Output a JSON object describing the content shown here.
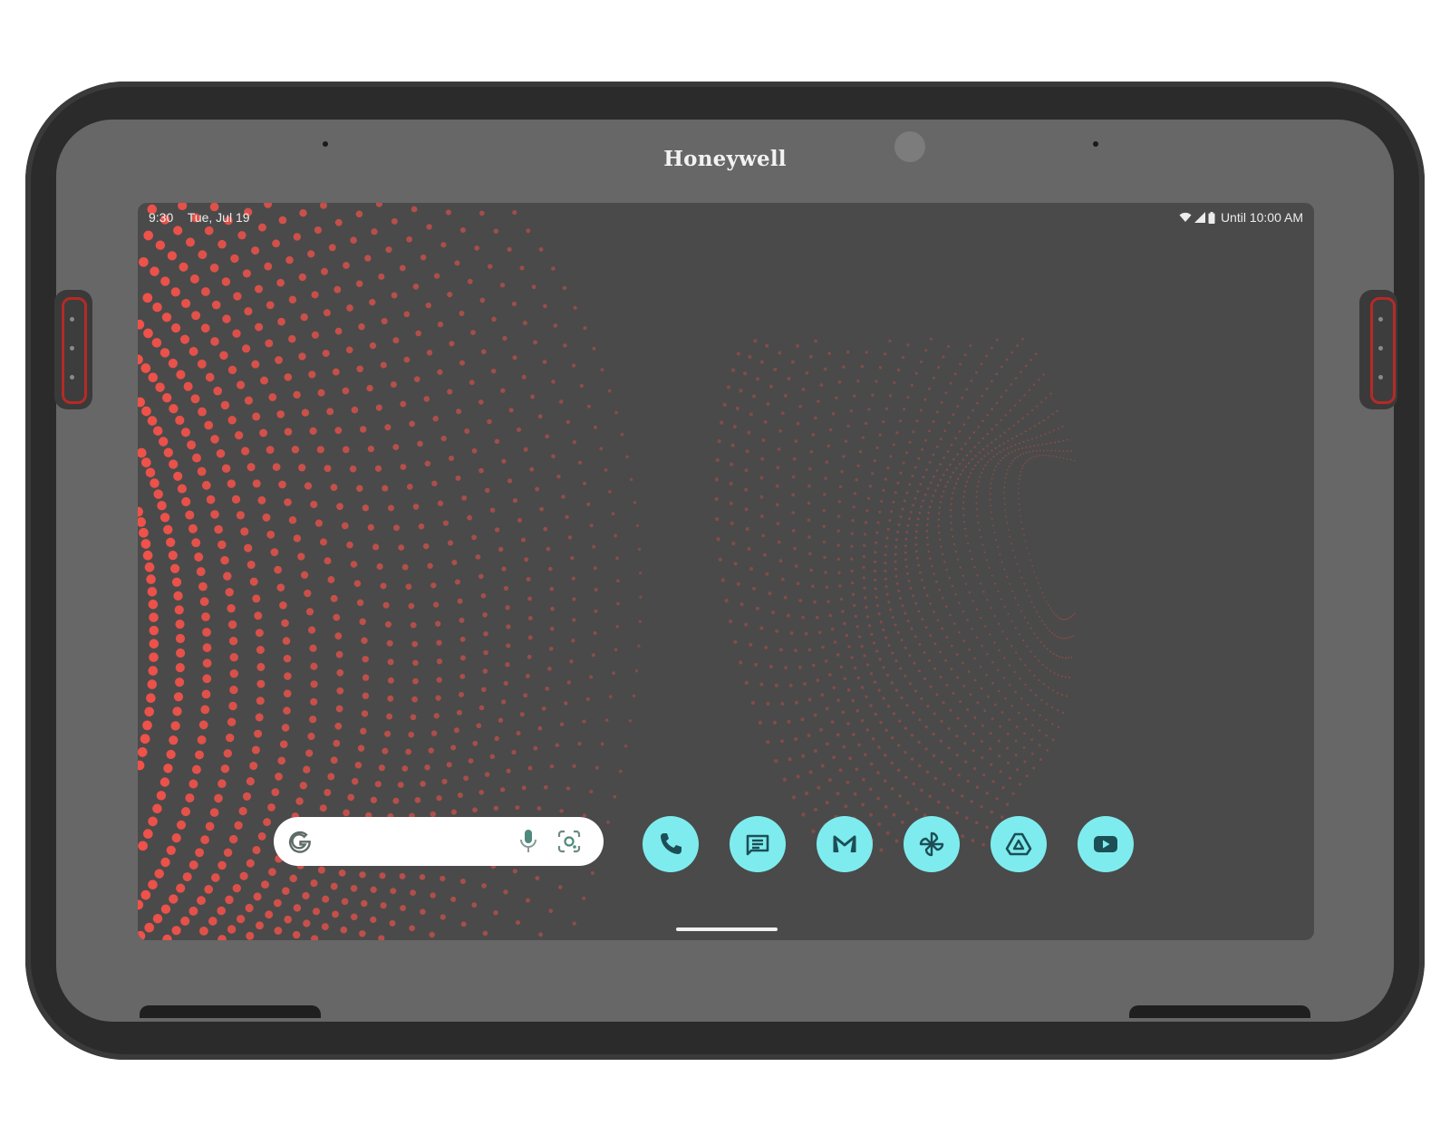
{
  "device": {
    "brand": "Honeywell"
  },
  "status_bar": {
    "time": "9:30",
    "date": "Tue, Jul 19",
    "right_text": "Until 10:00 AM",
    "icons": [
      "wifi-icon",
      "cellular-signal-icon",
      "battery-icon"
    ]
  },
  "search_widget": {
    "icons": [
      "google-g-icon",
      "microphone-icon",
      "google-lens-icon"
    ]
  },
  "dock": {
    "apps": [
      {
        "icon": "phone-icon"
      },
      {
        "icon": "messages-icon"
      },
      {
        "icon": "gmail-icon"
      },
      {
        "icon": "pinwheel-icon"
      },
      {
        "icon": "drive-icon"
      },
      {
        "icon": "youtube-icon"
      }
    ]
  },
  "colors": {
    "icon_bg": "#7eecef",
    "icon_fg": "#1c4f55",
    "wallpaper_dots": "#f0524a",
    "screen_bg": "#4a4a4a",
    "bezel": "#676767",
    "case": "#2b2b2b",
    "accent_button": "#b52a26"
  }
}
